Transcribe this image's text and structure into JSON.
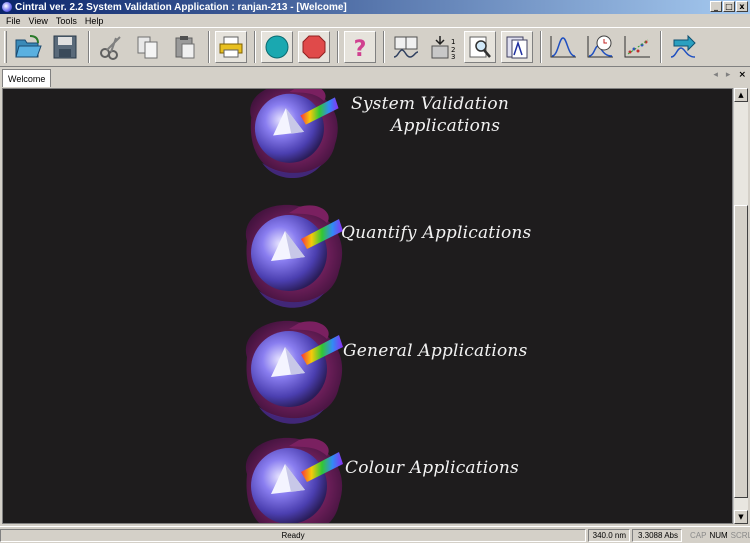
{
  "window": {
    "title": "Cintral ver. 2.2 System Validation Application : ranjan-213 - [Welcome]"
  },
  "window_buttons": {
    "minimize": "_",
    "maximize": "□",
    "close": "x"
  },
  "menu": [
    {
      "label": "File"
    },
    {
      "label": "View"
    },
    {
      "label": "Tools"
    },
    {
      "label": "Help"
    }
  ],
  "toolbar": {
    "buttons": [
      "open-folder-icon",
      "save-icon",
      "cut-scissors-icon",
      "copy-icon",
      "paste-icon",
      "print-icon",
      "start-cyan-circle-icon",
      "stop-red-octagon-icon",
      "help-question-icon",
      "method-book-icon",
      "sample-sequence-icon",
      "magnify-icon",
      "spectrum-document-icon",
      "peak-graph-icon",
      "timed-scan-icon",
      "scatter-graph-icon",
      "export-arrow-icon"
    ]
  },
  "tabs": [
    {
      "label": "Welcome",
      "active": true
    }
  ],
  "tab_controls": {
    "prev": "◂",
    "next": "▸",
    "close": "×"
  },
  "applications": [
    {
      "label_line1": "System Validation",
      "label_line2": "Applications"
    },
    {
      "label_line1": "Quantify Applications"
    },
    {
      "label_line1": "General Applications"
    },
    {
      "label_line1": "Colour Applications"
    }
  ],
  "scrollbar": {
    "up": "▲",
    "down": "▼"
  },
  "status": {
    "message": "Ready",
    "wavelength": "340.0 nm",
    "absorbance": "3.3088 Abs",
    "indicators": [
      {
        "label": "CAP",
        "active": false
      },
      {
        "label": "NUM",
        "active": true
      },
      {
        "label": "SCRL",
        "active": false
      }
    ]
  },
  "colors": {
    "background": "#1e1c1d",
    "title_start": "#0a246a",
    "title_end": "#a6caf0",
    "label_text": "#f2f2f2"
  }
}
